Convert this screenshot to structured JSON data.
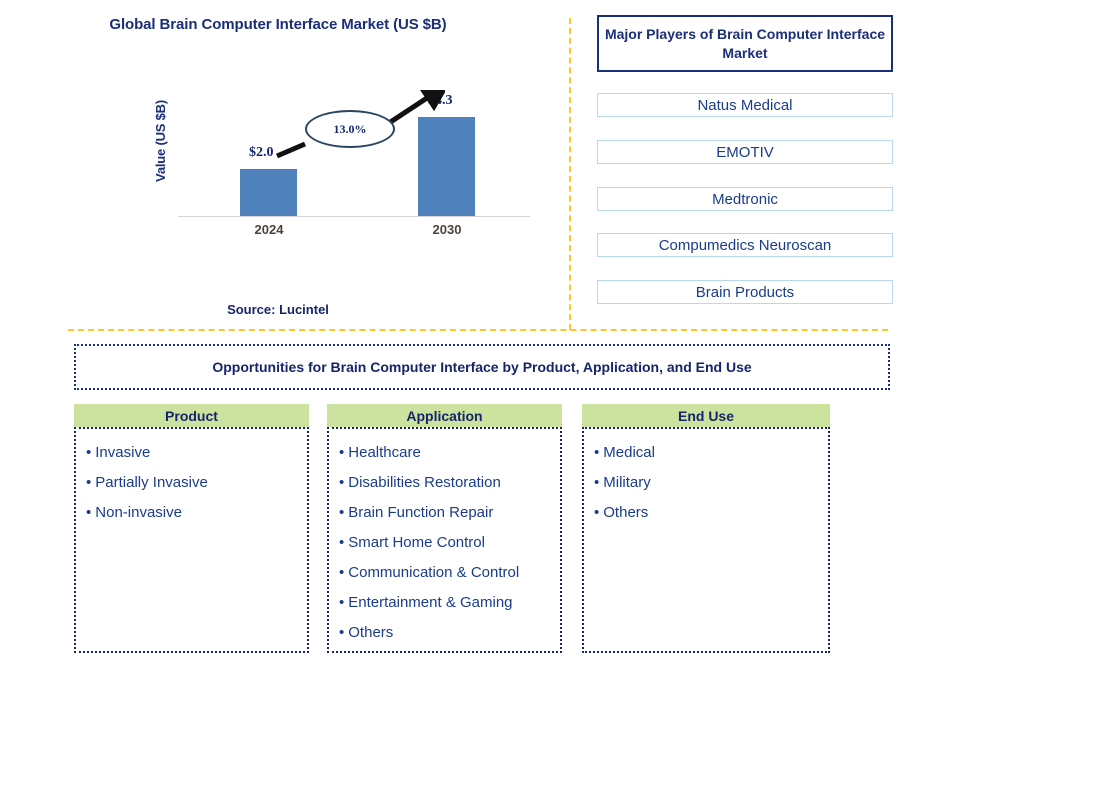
{
  "chart_panel": {
    "title": "Global Brain Computer Interface Market (US $B)",
    "source": "Source: Lucintel"
  },
  "chart_data": {
    "type": "bar",
    "title": "Global Brain Computer Interface Market (US $B)",
    "xlabel": "",
    "ylabel": "Value (US $B)",
    "categories": [
      "2024",
      "2030"
    ],
    "values": [
      2.0,
      4.3
    ],
    "value_labels": [
      "$2.0",
      "$4.3"
    ],
    "ylim": [
      0,
      4.8
    ],
    "grid": false,
    "legend": "none",
    "bar_color": "#4F81BD",
    "annotations": [
      {
        "name": "cagr",
        "text": "13.0%",
        "shape": "ellipse",
        "from_category": "2024",
        "to_category": "2030"
      }
    ]
  },
  "players_panel": {
    "header": "Major Players of Brain Computer Interface Market",
    "items": [
      {
        "name": "Natus Medical"
      },
      {
        "name": "EMOTIV"
      },
      {
        "name": "Medtronic"
      },
      {
        "name": "Compumedics Neuroscan"
      },
      {
        "name": "Brain Products"
      }
    ]
  },
  "opportunities": {
    "banner": "Opportunities for Brain Computer Interface by Product, Application, and End Use",
    "columns": [
      {
        "header": "Product",
        "items": [
          "Invasive",
          "Partially Invasive",
          "Non-invasive"
        ]
      },
      {
        "header": "Application",
        "items": [
          "Healthcare",
          "Disabilities Restoration",
          "Brain Function Repair",
          "Smart Home Control",
          "Communication & Control",
          "Entertainment & Gaming",
          "Others"
        ]
      },
      {
        "header": "End Use",
        "items": [
          "Medical",
          "Military",
          "Others"
        ]
      }
    ]
  },
  "bullet": "•",
  "colors": {
    "navy": "#1A2E7A",
    "bar_blue": "#4F81BD",
    "divider_yellow": "#FFC425",
    "header_green": "#CCE3A0"
  }
}
